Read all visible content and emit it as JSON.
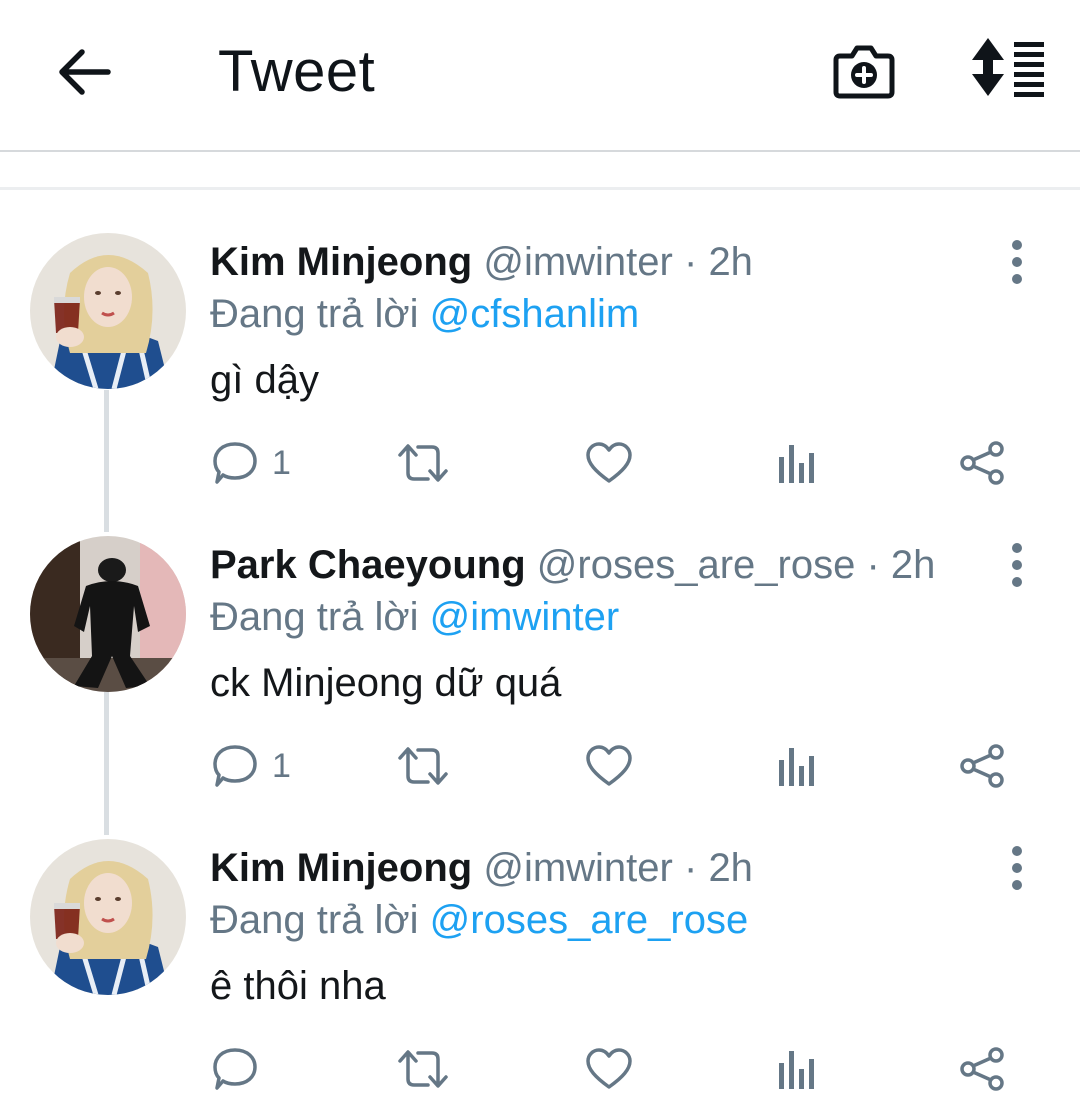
{
  "header": {
    "title": "Tweet",
    "back_icon": "arrow-left-icon",
    "camera_icon": "camera-plus-icon",
    "sort_icon": "sort-list-icon"
  },
  "colors": {
    "link": "#1da1f2",
    "secondary_text": "#657786",
    "primary_text": "#14171a",
    "thread_line": "#d9dee2"
  },
  "tweets": [
    {
      "display_name": "Kim Minjeong",
      "handle": "@imwinter",
      "separator": "·",
      "time": "2h",
      "reply_prefix": "Đang trả lời",
      "reply_to": "@cfshanlim",
      "text": "gì dậy",
      "reply_count": "1",
      "avatar": "blonde-woman-blue-jacket-avatar"
    },
    {
      "display_name": "Park Chaeyoung",
      "handle": "@roses_are_rose",
      "separator": "·",
      "time": "2h",
      "reply_prefix": "Đang trả lời",
      "reply_to": "@imwinter",
      "text": "ck Minjeong dữ quá",
      "reply_count": "1",
      "avatar": "person-black-outfit-avatar"
    },
    {
      "display_name": "Kim Minjeong",
      "handle": "@imwinter",
      "separator": "·",
      "time": "2h",
      "reply_prefix": "Đang trả lời",
      "reply_to": "@roses_are_rose",
      "text": "ê thôi nha",
      "reply_count": "",
      "avatar": "blonde-woman-blue-jacket-avatar"
    }
  ]
}
